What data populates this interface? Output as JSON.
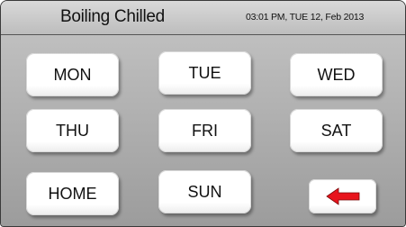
{
  "header": {
    "title": "Boiling Chilled",
    "datetime": "03:01 PM, TUE 12, Feb 2013"
  },
  "days": {
    "mon": "MON",
    "tue": "TUE",
    "wed": "WED",
    "thu": "THU",
    "fri": "FRI",
    "sat": "SAT",
    "home": "HOME",
    "sun": "SUN"
  },
  "back_button": {
    "icon": "left-arrow-icon",
    "color": "#e8141c"
  }
}
